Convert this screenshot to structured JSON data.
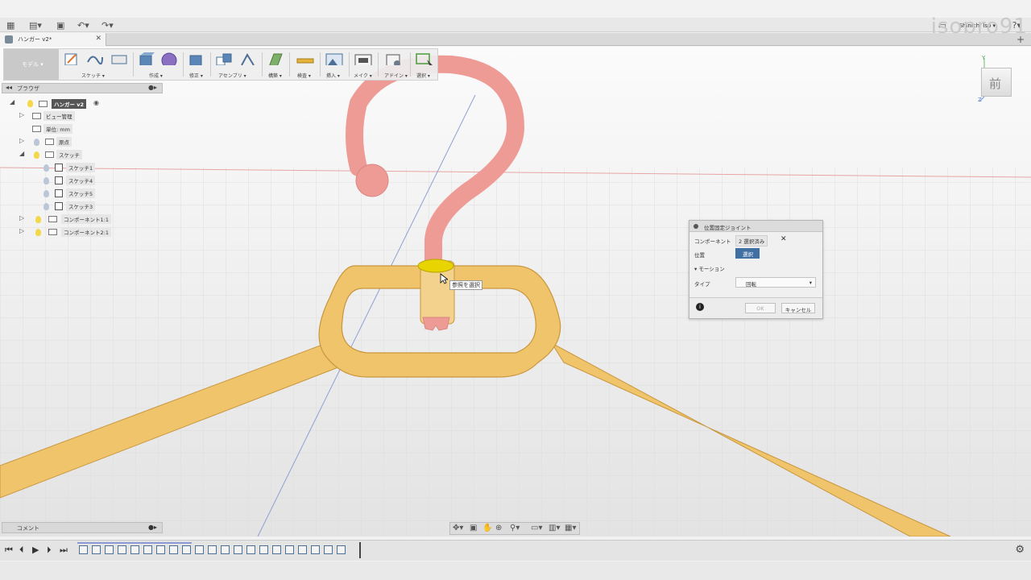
{
  "app": {
    "watermark": "isopro91",
    "user_name": "Shinichi Iso ▾",
    "document_tab": "ハンガー v2*"
  },
  "toolbar": {
    "workspace": "モデル ▾",
    "groups": [
      "スケッチ ▾",
      "作成 ▾",
      "修正 ▾",
      "アセンブリ ▾",
      "構築 ▾",
      "検査 ▾",
      "挿入 ▾",
      "メイク ▾",
      "アドイン ▾",
      "選択 ▾"
    ]
  },
  "browser": {
    "title": "ブラウザ",
    "root": "ハンガー v2",
    "items": [
      "ビュー管理",
      "単位: mm",
      "原点",
      "スケッチ",
      "スケッチ1",
      "スケッチ4",
      "スケッチ5",
      "スケッチ3",
      "コンポーネント1:1",
      "コンポーネント2:1"
    ]
  },
  "comment": {
    "title": "コメント"
  },
  "viewcube": {
    "face": "前",
    "axes": [
      "Y",
      "Z"
    ]
  },
  "dialog": {
    "title": "位置固定ジョイント",
    "component_label": "コンポーネント",
    "component_value": "2 選択済み",
    "position_label": "位置",
    "position_button": "選択",
    "motion_section": "モーション",
    "type_label": "タイプ",
    "type_value": "回転",
    "ok_label": "OK",
    "cancel_label": "キャンセル"
  },
  "tooltip": {
    "text": "参照を選択"
  },
  "colors": {
    "hanger_body": "#f0c46a",
    "hook": "#ee9b95",
    "selection": "#e8d400",
    "dialog_button": "#3f6fa3"
  }
}
